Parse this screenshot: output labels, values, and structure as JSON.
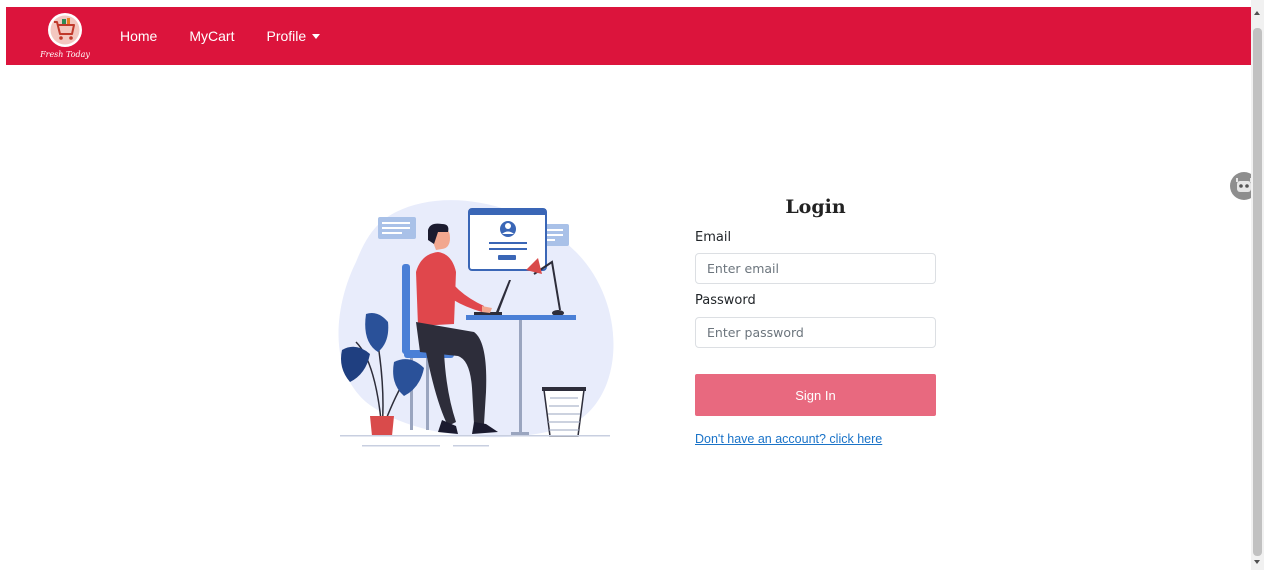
{
  "navbar": {
    "logo_text": "Fresh Today",
    "links": {
      "home": "Home",
      "mycart": "MyCart",
      "profile": "Profile"
    },
    "color": "#dc143c"
  },
  "login": {
    "title": "Login",
    "email_label": "Email",
    "email_placeholder": "Enter email",
    "email_value": "",
    "password_label": "Password",
    "password_placeholder": "Enter password",
    "password_value": "",
    "signin_label": "Sign In",
    "signup_link": "Don't have an account? click here",
    "button_color": "#e8697f"
  },
  "icons": {
    "logo": "shopping-cart-logo-icon",
    "profile_caret": "chevron-down-icon",
    "float": "extension-icon"
  }
}
